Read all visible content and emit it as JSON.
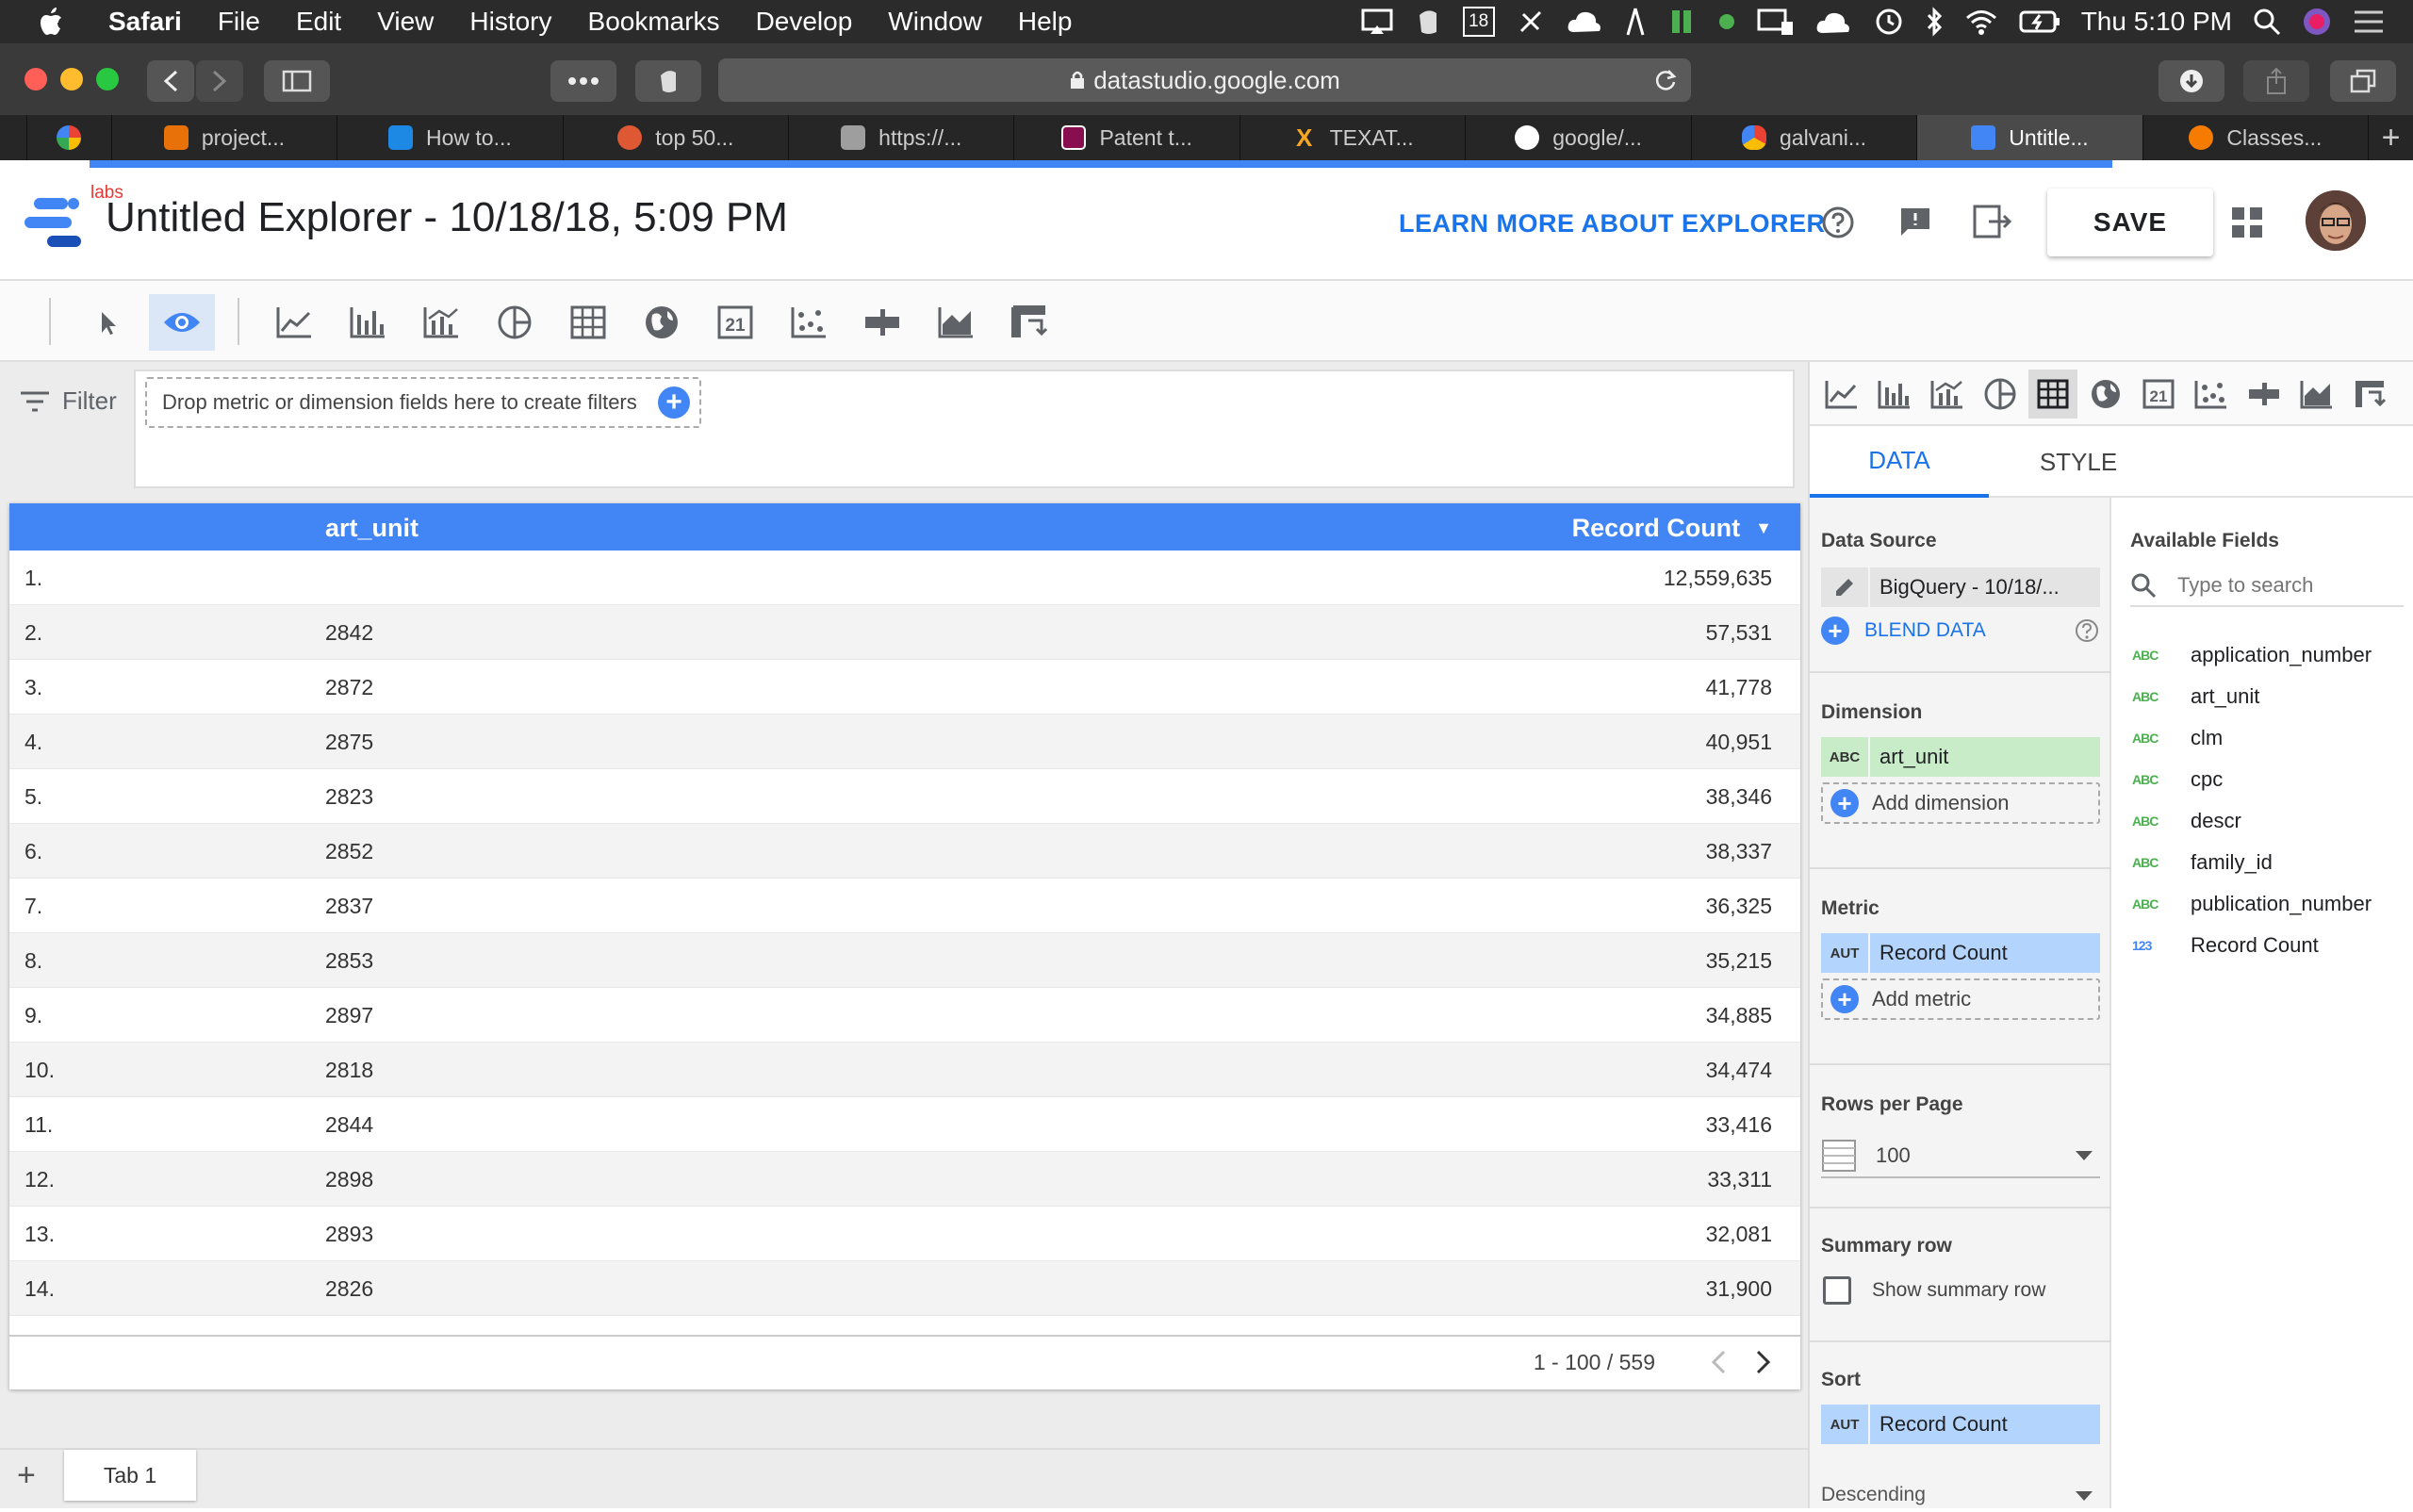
{
  "menubar": {
    "app": "Safari",
    "items": [
      "File",
      "Edit",
      "View",
      "History",
      "Bookmarks",
      "Develop",
      "Window",
      "Help"
    ],
    "clock": "Thu 5:10 PM",
    "calendar_day": "18"
  },
  "browser": {
    "url": "datastudio.google.com",
    "tabs": [
      {
        "label": "project...",
        "color": "#e8710a"
      },
      {
        "label": "How to...",
        "color": "#1e88e5"
      },
      {
        "label": "top 50...",
        "color": "#de5833"
      },
      {
        "label": "https://...",
        "color": "#9e9e9e"
      },
      {
        "label": "Patent t...",
        "color": "#880e4f"
      },
      {
        "label": "TEXAT...",
        "color": "#f5a623"
      },
      {
        "label": "google/...",
        "color": "#ffffff"
      },
      {
        "label": "galvani...",
        "color": "#fbbc04"
      },
      {
        "label": "Untitle...",
        "color": "#4285f4"
      },
      {
        "label": "Classes...",
        "color": "#f57c00"
      }
    ]
  },
  "app": {
    "badge": "labs",
    "title": "Untitled Explorer - 10/18/18, 5:09 PM",
    "learn_more": "LEARN MORE ABOUT EXPLORER",
    "save": "SAVE",
    "accent": "#4285f4"
  },
  "filter": {
    "label": "Filter",
    "dropzone": "Drop metric or dimension fields here to create filters"
  },
  "table": {
    "columns": [
      "art_unit",
      "Record Count"
    ],
    "sort_indicator": "▼",
    "rows": [
      {
        "n": "1.",
        "art_unit": "",
        "count": "12,559,635"
      },
      {
        "n": "2.",
        "art_unit": "2842",
        "count": "57,531"
      },
      {
        "n": "3.",
        "art_unit": "2872",
        "count": "41,778"
      },
      {
        "n": "4.",
        "art_unit": "2875",
        "count": "40,951"
      },
      {
        "n": "5.",
        "art_unit": "2823",
        "count": "38,346"
      },
      {
        "n": "6.",
        "art_unit": "2852",
        "count": "38,337"
      },
      {
        "n": "7.",
        "art_unit": "2837",
        "count": "36,325"
      },
      {
        "n": "8.",
        "art_unit": "2853",
        "count": "35,215"
      },
      {
        "n": "9.",
        "art_unit": "2897",
        "count": "34,885"
      },
      {
        "n": "10.",
        "art_unit": "2818",
        "count": "34,474"
      },
      {
        "n": "11.",
        "art_unit": "2844",
        "count": "33,416"
      },
      {
        "n": "12.",
        "art_unit": "2898",
        "count": "33,311"
      },
      {
        "n": "13.",
        "art_unit": "2893",
        "count": "32,081"
      },
      {
        "n": "14.",
        "art_unit": "2826",
        "count": "31,900"
      }
    ],
    "pager": "1 - 100 / 559"
  },
  "page_tabs": {
    "add": "+",
    "tab1": "Tab 1"
  },
  "panel": {
    "tabs": [
      "DATA",
      "STYLE"
    ],
    "data_source_label": "Data Source",
    "data_source": "BigQuery - 10/18/...",
    "blend": "BLEND DATA",
    "dimension_label": "Dimension",
    "dimension": {
      "tag": "ABC",
      "name": "art_unit"
    },
    "add_dimension": "Add dimension",
    "metric_label": "Metric",
    "metric": {
      "tag": "AUT",
      "name": "Record Count"
    },
    "add_metric": "Add metric",
    "rows_per_page_label": "Rows per Page",
    "rows_per_page": "100",
    "summary_label": "Summary row",
    "summary_checkbox": "Show summary row",
    "sort_label": "Sort",
    "sort": {
      "tag": "AUT",
      "name": "Record Count"
    },
    "sort_order": "Descending",
    "available_fields_label": "Available Fields",
    "search_placeholder": "Type to search",
    "fields": [
      {
        "type": "ABC",
        "name": "application_number"
      },
      {
        "type": "ABC",
        "name": "art_unit"
      },
      {
        "type": "ABC",
        "name": "clm"
      },
      {
        "type": "ABC",
        "name": "cpc"
      },
      {
        "type": "ABC",
        "name": "descr"
      },
      {
        "type": "ABC",
        "name": "family_id"
      },
      {
        "type": "ABC",
        "name": "publication_number"
      },
      {
        "type": "123",
        "name": "Record Count"
      }
    ]
  }
}
